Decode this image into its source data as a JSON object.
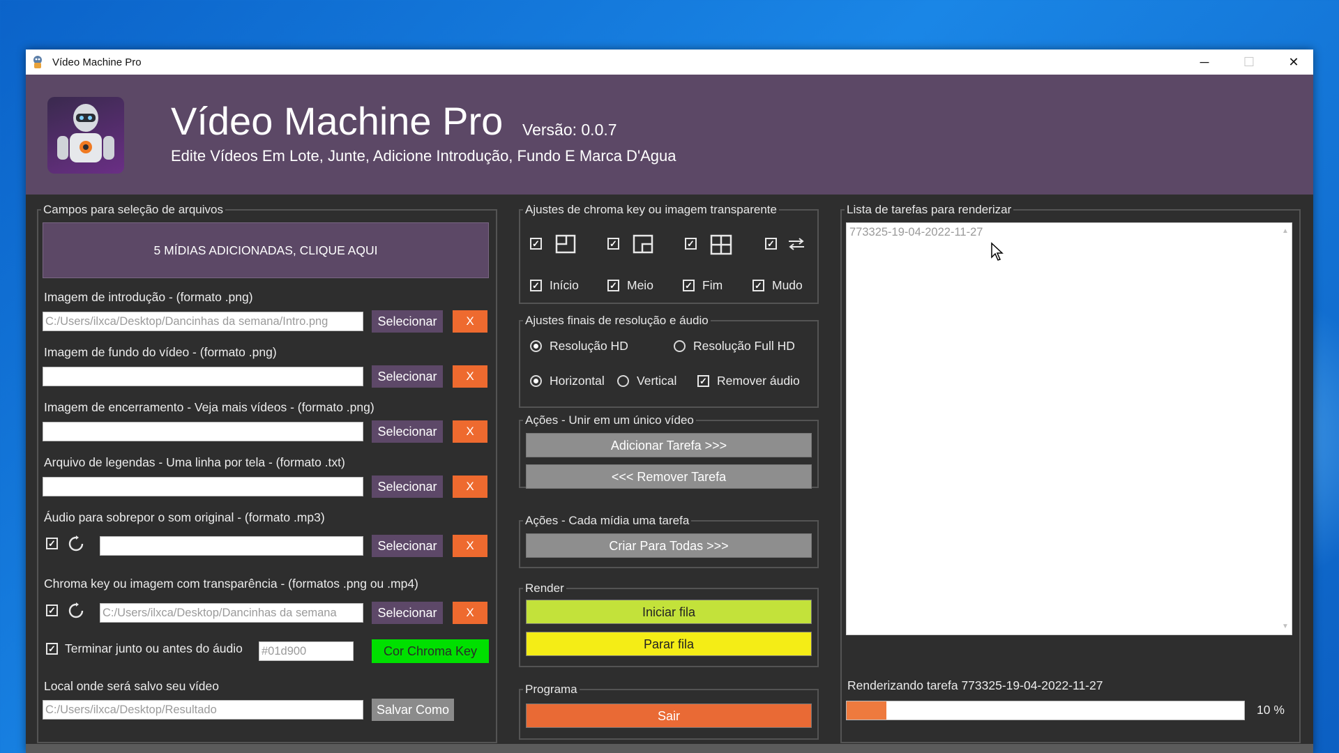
{
  "window": {
    "title": "Vídeo Machine Pro",
    "minimize_glyph": "─",
    "maximize_glyph": "☐",
    "close_glyph": "✕"
  },
  "header": {
    "title": "Vídeo Machine Pro",
    "version": "Versão: 0.0.7",
    "subtitle": "Edite Vídeos Em Lote, Junte, Adicione Introdução, Fundo E Marca D'Agua"
  },
  "files": {
    "group_label": "Campos para seleção de arquivos",
    "media_button": "5 MÍDIAS ADICIONADAS, CLIQUE AQUI",
    "select_label": "Selecionar",
    "clear_label": "X",
    "intro": {
      "label": "Imagem de introdução - (formato .png)",
      "value": "C:/Users/ilxca/Desktop/Dancinhas da semana/Intro.png"
    },
    "background": {
      "label": "Imagem de fundo do vídeo - (formato .png)",
      "value": ""
    },
    "ending": {
      "label": "Imagem de encerramento - Veja mais vídeos - (formato .png)",
      "value": ""
    },
    "subtitles": {
      "label": "Arquivo de legendas - Uma linha por tela - (formato .txt)",
      "value": ""
    },
    "audio": {
      "label": "Áudio para sobrepor o som original - (formato .mp3)",
      "value": "",
      "checked": "✓"
    },
    "chroma": {
      "label": "Chroma key ou imagem com transparência - (formatos .png ou .mp4)",
      "value": "C:/Users/ilxca/Desktop/Dancinhas da semana",
      "checked": "✓"
    },
    "finish_with_audio": {
      "label": "Terminar junto ou antes do áudio",
      "checked": "✓"
    },
    "chroma_color_value": "#01d900",
    "chroma_color_button": "Cor Chroma Key",
    "chroma_color_hex": "#00e000",
    "save_label": "Local onde será salvo seu vídeo",
    "save_value": "C:/Users/ilxca/Desktop/Resultado",
    "save_button": "Salvar Como"
  },
  "chroma_adjust": {
    "group_label": "Ajustes de chroma key ou imagem transparente",
    "options": [
      {
        "label": "Início",
        "checked": "✓"
      },
      {
        "label": "Meio",
        "checked": "✓"
      },
      {
        "label": "Fim",
        "checked": "✓"
      },
      {
        "label": "Mudo",
        "checked": "✓"
      }
    ],
    "position_checks": [
      "✓",
      "✓",
      "✓",
      "✓"
    ],
    "position_icons": [
      "position-top-left-icon",
      "position-bottom-right-icon",
      "grid-four-icon",
      "swap-arrows-icon"
    ]
  },
  "final_adjust": {
    "group_label": "Ajustes finais de resolução e áudio",
    "hd": "Resolução HD",
    "full_hd": "Resolução Full HD",
    "horizontal": "Horizontal",
    "vertical": "Vertical",
    "remove_audio": "Remover áudio",
    "remove_audio_checked": "✓"
  },
  "actions_join": {
    "group_label": "Ações - Unir em um único vídeo",
    "add": "Adicionar Tarefa >>>",
    "remove": "<<< Remover Tarefa"
  },
  "actions_each": {
    "group_label": "Ações - Cada mídia uma tarefa",
    "create_all": "Criar Para Todas >>>"
  },
  "render": {
    "group_label": "Render",
    "start": "Iniciar fila",
    "stop": "Parar fila"
  },
  "program": {
    "group_label": "Programa",
    "exit": "Sair"
  },
  "tasks": {
    "group_label": "Lista de tarefas para renderizar",
    "items": [
      "773325-19-04-2022-11-27"
    ],
    "status": "Renderizando tarefa 773325-19-04-2022-11-27",
    "progress_percent": 10,
    "progress_label": "10 %"
  },
  "colors": {
    "header_purple": "#5c4866",
    "accent_orange": "#ee6a2f",
    "start_green": "#c3e23a",
    "stop_yellow": "#f4ed16",
    "exit_orange": "#e96a35",
    "panel_bg": "#2e2e2e"
  }
}
